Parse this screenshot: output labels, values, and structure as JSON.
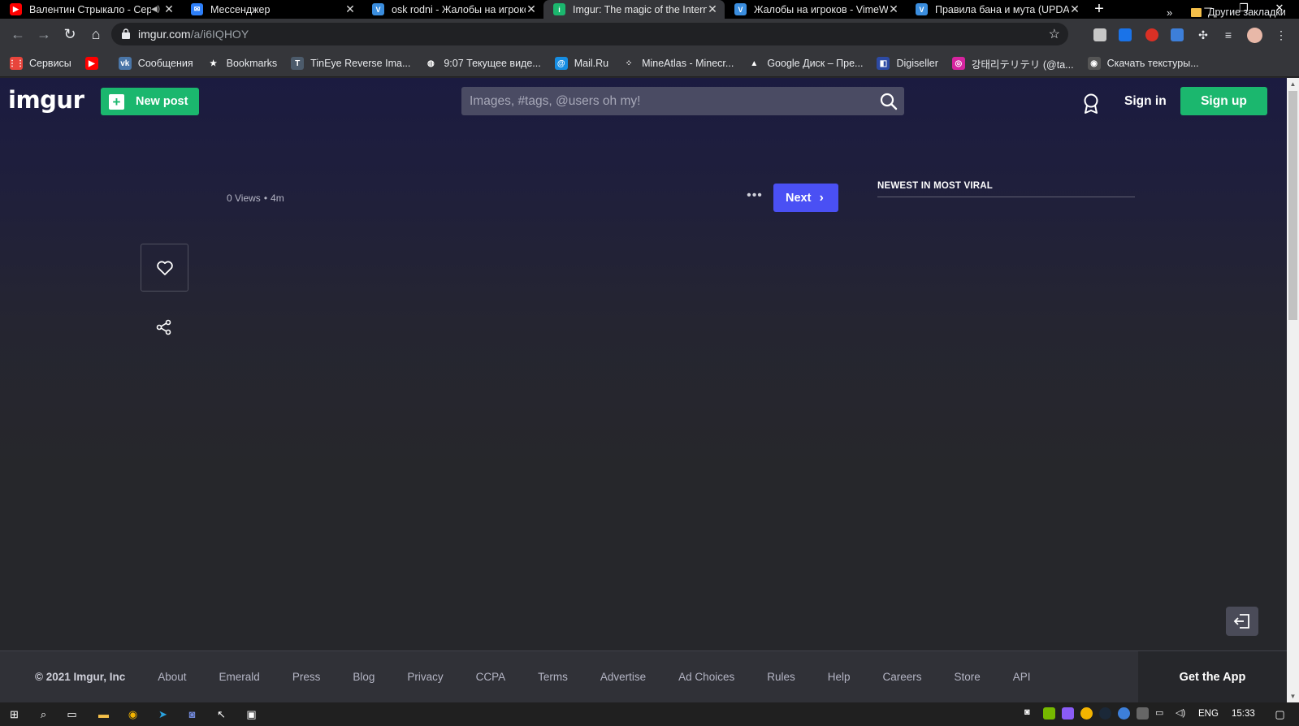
{
  "browser": {
    "tabs": [
      {
        "title": "Валентин Стрыкало - Сер",
        "icon": "youtube-icon",
        "color": "#ff0000",
        "glyph": "▶",
        "audio": true,
        "active": false
      },
      {
        "title": "Мессенджер",
        "icon": "messenger-icon",
        "color": "#2d7ff9",
        "glyph": "✉",
        "audio": false,
        "active": false
      },
      {
        "title": "osk rodni - Жалобы на игроко",
        "icon": "vime-icon",
        "color": "#3a8dde",
        "glyph": "V",
        "audio": false,
        "active": false
      },
      {
        "title": "Imgur: The magic of the Interne",
        "icon": "imgur-icon",
        "color": "#1bb76e",
        "glyph": "i",
        "audio": false,
        "active": true
      },
      {
        "title": "Жалобы на игроков - VimeWo",
        "icon": "vime-icon",
        "color": "#3a8dde",
        "glyph": "V",
        "audio": false,
        "active": false
      },
      {
        "title": "Правила бана и мута (UPDATE",
        "icon": "vime-icon",
        "color": "#3a8dde",
        "glyph": "V",
        "audio": false,
        "active": false
      }
    ],
    "new_tab": "+",
    "url": {
      "host": "imgur.com",
      "path": "/a/i6IQHOY"
    },
    "bookmarks": [
      {
        "label": "Сервисы",
        "icon": "apps-grid-icon",
        "color": "#e8453c",
        "glyph": "⋮⋮"
      },
      {
        "label": "",
        "icon": "youtube-icon",
        "color": "#ff0000",
        "glyph": "▶"
      },
      {
        "label": "Сообщения",
        "icon": "vk-icon",
        "color": "#4a76a8",
        "glyph": "vk"
      },
      {
        "label": "Bookmarks",
        "icon": "star-icon",
        "color": "#35363a",
        "glyph": "★"
      },
      {
        "label": "TinEye Reverse Ima...",
        "icon": "tineye-icon",
        "color": "#4c5b6b",
        "glyph": "T"
      },
      {
        "label": "9:07 Текущее виде...",
        "icon": "globe-icon",
        "color": "#35363a",
        "glyph": "◍"
      },
      {
        "label": "Mail.Ru",
        "icon": "mailru-icon",
        "color": "#168de2",
        "glyph": "@"
      },
      {
        "label": "MineAtlas - Minecr...",
        "icon": "mineatlas-icon",
        "color": "#35363a",
        "glyph": "⁘"
      },
      {
        "label": "Google Диск – Пре...",
        "icon": "google-drive-icon",
        "color": "#35363a",
        "glyph": "▲"
      },
      {
        "label": "Digiseller",
        "icon": "digiseller-icon",
        "color": "#2d4aa3",
        "glyph": "◧"
      },
      {
        "label": "강태리テリテリ (@ta...",
        "icon": "instagram-icon",
        "color": "#d6249f",
        "glyph": "◎"
      },
      {
        "label": "Скачать текстуры...",
        "icon": "site-icon",
        "color": "#555555",
        "glyph": "◉"
      }
    ],
    "bookmarks_more": "»",
    "other_bookmarks": "Другие закладки"
  },
  "site": {
    "logo": "imgur",
    "new_post": "New post",
    "search_placeholder": "Images, #tags, @users oh my!",
    "sign_in": "Sign in",
    "sign_up": "Sign up"
  },
  "post": {
    "views": "0 Views",
    "age": "4m",
    "next": "Next"
  },
  "sidebar": {
    "title": "NEWEST IN MOST VIRAL"
  },
  "footer": {
    "copyright": "© 2021 Imgur, Inc",
    "links": [
      "About",
      "Emerald",
      "Press",
      "Blog",
      "Privacy",
      "CCPA",
      "Terms",
      "Advertise",
      "Ad Choices",
      "Rules",
      "Help",
      "Careers",
      "Store",
      "API"
    ],
    "get_app": "Get the App"
  },
  "taskbar": {
    "language": "ENG",
    "time": "15:33"
  },
  "colors": {
    "brand_green": "#1bb76e",
    "next_blue": "#4a50f4",
    "header_bg": "#1b1b40",
    "page_bg": "#26272b"
  }
}
